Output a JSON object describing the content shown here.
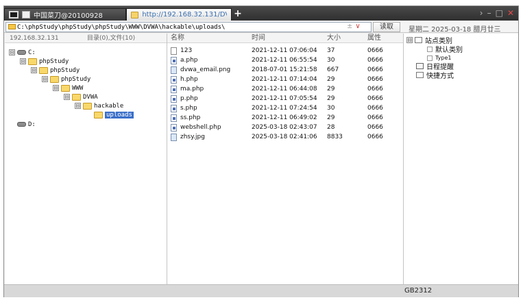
{
  "tabs": [
    {
      "label": "中国菜刀@20100928",
      "icon": "monitor-icon"
    },
    {
      "label": "http://192.168.32.131/DVW...",
      "icon": "folder-icon"
    }
  ],
  "new_tab_label": "+",
  "window_controls": {
    "chevron": "›",
    "minimize": "–",
    "maximize": "□",
    "close": "✕"
  },
  "address": {
    "path": "C:\\phpStudy\\phpStudy\\phpStudy\\WWW\\DVWA\\hackable\\uploads\\",
    "plus": "±",
    "dropdown": "∨",
    "read_button": "读取",
    "date": "星期二 2025-03-18 腊月廿三"
  },
  "tree_header": {
    "ip": "192.168.32.131",
    "counts": "目录(0),文件(10)"
  },
  "tree": [
    {
      "label": "C:",
      "type": "drive",
      "expander": "⊟"
    },
    {
      "label": "phpStudy",
      "type": "folder",
      "expander": "⊟"
    },
    {
      "label": "phpStudy",
      "type": "folder",
      "expander": "⊟"
    },
    {
      "label": "phpStudy",
      "type": "folder",
      "expander": "⊟"
    },
    {
      "label": "WWW",
      "type": "folder",
      "expander": "⊟"
    },
    {
      "label": "DVWA",
      "type": "folder",
      "expander": "⊟"
    },
    {
      "label": "hackable",
      "type": "folder",
      "expander": "⊟"
    },
    {
      "label": "uploads",
      "type": "folder",
      "expander": "",
      "selected": true
    },
    {
      "label": "D:",
      "type": "drive",
      "expander": ""
    }
  ],
  "file_columns": {
    "name": "名称",
    "time": "时间",
    "size": "大小",
    "attr": "属性"
  },
  "files": [
    {
      "name": "123",
      "time": "2021-12-11 07:06:04",
      "size": "37",
      "attr": "0666",
      "icon": "generic-file-icon"
    },
    {
      "name": "a.php",
      "time": "2021-12-11 06:55:54",
      "size": "30",
      "attr": "0666",
      "icon": "php-file-icon"
    },
    {
      "name": "dvwa_email.png",
      "time": "2018-07-01 15:21:58",
      "size": "667",
      "attr": "0666",
      "icon": "image-file-icon"
    },
    {
      "name": "h.php",
      "time": "2021-12-11 07:14:04",
      "size": "29",
      "attr": "0666",
      "icon": "php-file-icon"
    },
    {
      "name": "ma.php",
      "time": "2021-12-11 06:44:08",
      "size": "29",
      "attr": "0666",
      "icon": "php-file-icon"
    },
    {
      "name": "p.php",
      "time": "2021-12-11 07:05:54",
      "size": "29",
      "attr": "0666",
      "icon": "php-file-icon"
    },
    {
      "name": "s.php",
      "time": "2021-12-11 07:24:54",
      "size": "30",
      "attr": "0666",
      "icon": "php-file-icon"
    },
    {
      "name": "ss.php",
      "time": "2021-12-11 06:49:02",
      "size": "29",
      "attr": "0666",
      "icon": "php-file-icon"
    },
    {
      "name": "webshell.php",
      "time": "2025-03-18 02:43:07",
      "size": "28",
      "attr": "0666",
      "icon": "php-file-icon"
    },
    {
      "name": "zhsy.jpg",
      "time": "2025-03-18 02:41:06",
      "size": "8833",
      "attr": "0666",
      "icon": "image-file-icon"
    }
  ],
  "side": {
    "site_category": "站点类别",
    "default_category": "默认类别",
    "type1": "Type1",
    "schedule": "日程提醒",
    "shortcuts": "快捷方式",
    "expander": "⊟"
  },
  "status": {
    "encoding": "GB2312"
  },
  "colors": {
    "selection": "#3b6fc9",
    "folder": "#f9d86b",
    "close": "#e04848"
  }
}
